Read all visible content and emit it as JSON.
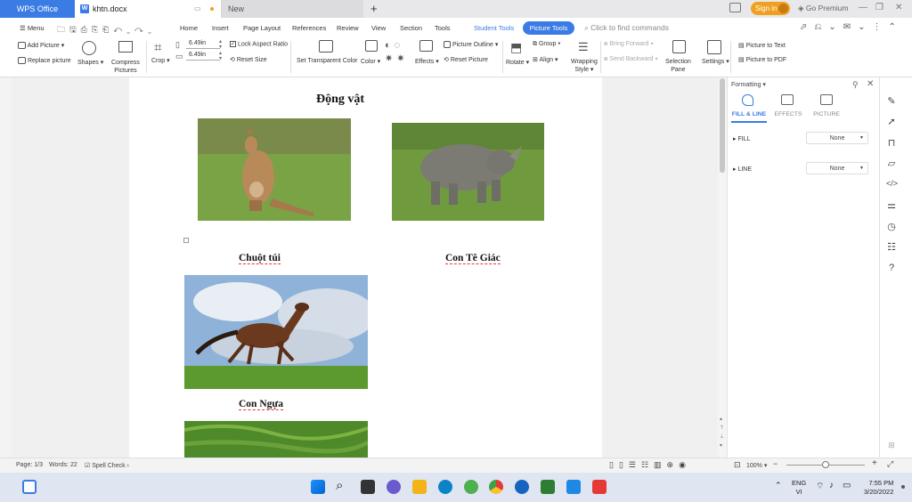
{
  "titlebar": {
    "app_name": "WPS Office",
    "doc_tab": "khtn.docx",
    "new_tab": "New",
    "plus": "+",
    "signin": "Sign in",
    "premium": "Go Premium"
  },
  "menu": {
    "menu_label": "Menu",
    "items": [
      "Home",
      "Insert",
      "Page Layout",
      "References",
      "Review",
      "View",
      "Section",
      "Tools"
    ],
    "student_tools": "Student Tools",
    "picture_tools": "Picture Tools",
    "search_placeholder": "Click to find commands"
  },
  "ribbon": {
    "add_picture": "Add Picture",
    "replace_picture": "Replace picture",
    "shapes": "Shapes",
    "compress1": "Compress",
    "compress2": "Pictures",
    "crop": "Crop",
    "width": "6.49in",
    "height": "6.49in",
    "lock_aspect": "Lock Aspect Ratio",
    "reset_size": "Reset Size",
    "set_transparent": "Set Transparent Color",
    "color": "Color",
    "effects": "Effects",
    "picture_outline": "Picture Outline",
    "reset_picture": "Reset Picture",
    "rotate": "Rotate",
    "group": "Group",
    "align": "Align",
    "wrapping1": "Wrapping",
    "wrapping2": "Style",
    "bring_forward": "Bring Forward",
    "send_backward": "Send Backward",
    "selection1": "Selection",
    "selection2": "Pane",
    "settings": "Settings",
    "picture_to_text": "Picture to Text",
    "picture_to_pdf": "Picture to PDF"
  },
  "document": {
    "heading": "Động vật",
    "captions": [
      "Chuột túi",
      "Con Tê Giác",
      "Con Ngựa"
    ]
  },
  "pane": {
    "title": "Formatting",
    "tabs": [
      "FILL & LINE",
      "EFFECTS",
      "PICTURE"
    ],
    "fill_label": "FILL",
    "fill_value": "None",
    "line_label": "LINE",
    "line_value": "None"
  },
  "status": {
    "page": "Page: 1/3",
    "words": "Words: 22",
    "spell": "Spell Check",
    "zoom": "100%"
  },
  "taskbar": {
    "lang1": "ENG",
    "lang2": "VI",
    "time": "7:55 PM",
    "date": "3/20/2022"
  },
  "colors": {
    "accent": "#3a7be4",
    "signin": "#f0a020"
  }
}
